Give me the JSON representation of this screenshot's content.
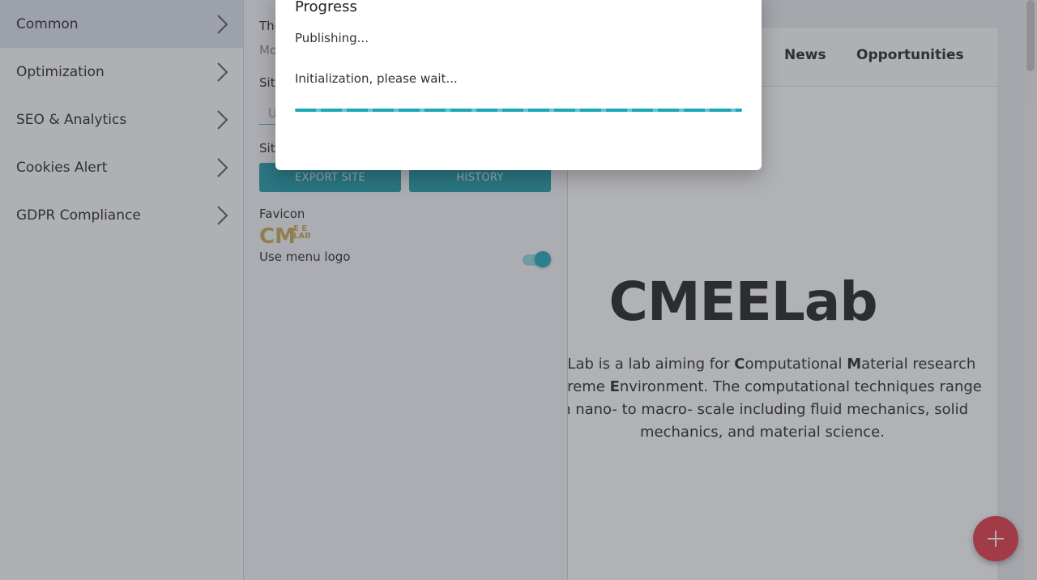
{
  "sidebar": {
    "items": [
      {
        "label": "Common",
        "active": true
      },
      {
        "label": "Optimization"
      },
      {
        "label": "SEO & Analytics"
      },
      {
        "label": "Cookies Alert"
      },
      {
        "label": "GDPR Compliance"
      }
    ]
  },
  "panel": {
    "theme_label": "The",
    "theme_value": "Mo",
    "site_name_label": "Site",
    "site_name_placeholder": "U",
    "site_label": "Site",
    "export_button": "EXPORT SITE",
    "history_button": "HISTORY",
    "favicon_label": "Favicon",
    "favicon_text_main": "CM",
    "favicon_text_small": "E E LAB",
    "use_menu_logo_label": "Use menu logo",
    "use_menu_logo_on": true
  },
  "preview": {
    "nav": [
      "News",
      "Opportunities"
    ],
    "logo": "CMEELab",
    "hero_parts": [
      "EELab is a lab aiming for ",
      "C",
      "omputational ",
      "M",
      "aterial research",
      "E",
      "xtreme ",
      "E",
      "nvironment. The computational techniques range",
      "m nano- to macro- scale including fluid mechanics, solid",
      "mechanics, and material science."
    ]
  },
  "dialog": {
    "title": "Progress",
    "status": "Publishing...",
    "detail": "Initialization, please wait...",
    "progress": 1.0
  },
  "colors": {
    "accent": "#1aa8b8",
    "fab": "#e53242"
  },
  "icons": {
    "sidebar_chevron": "chevron-right-icon",
    "fab": "plus-icon"
  }
}
